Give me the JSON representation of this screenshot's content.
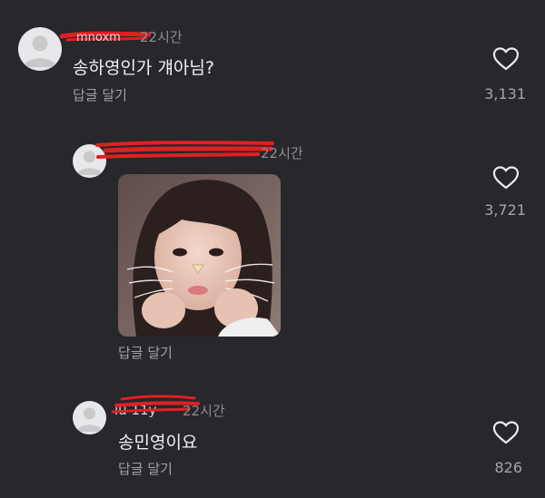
{
  "comments": [
    {
      "time": "22시간",
      "text": "송하영인가 걔아님?",
      "reply_label": "답글 달기",
      "likes": "3,131"
    },
    {
      "time": "22시간",
      "reply_label": "답글 달기",
      "likes": "3,721"
    },
    {
      "time": "22시간",
      "text": "송민영이요",
      "reply_label": "답글 달기",
      "likes": "826"
    }
  ],
  "icons": {
    "avatar": "default-profile-icon",
    "like": "heart-outline-icon"
  },
  "colors": {
    "background": "#27272c",
    "redaction": "#e02020"
  }
}
